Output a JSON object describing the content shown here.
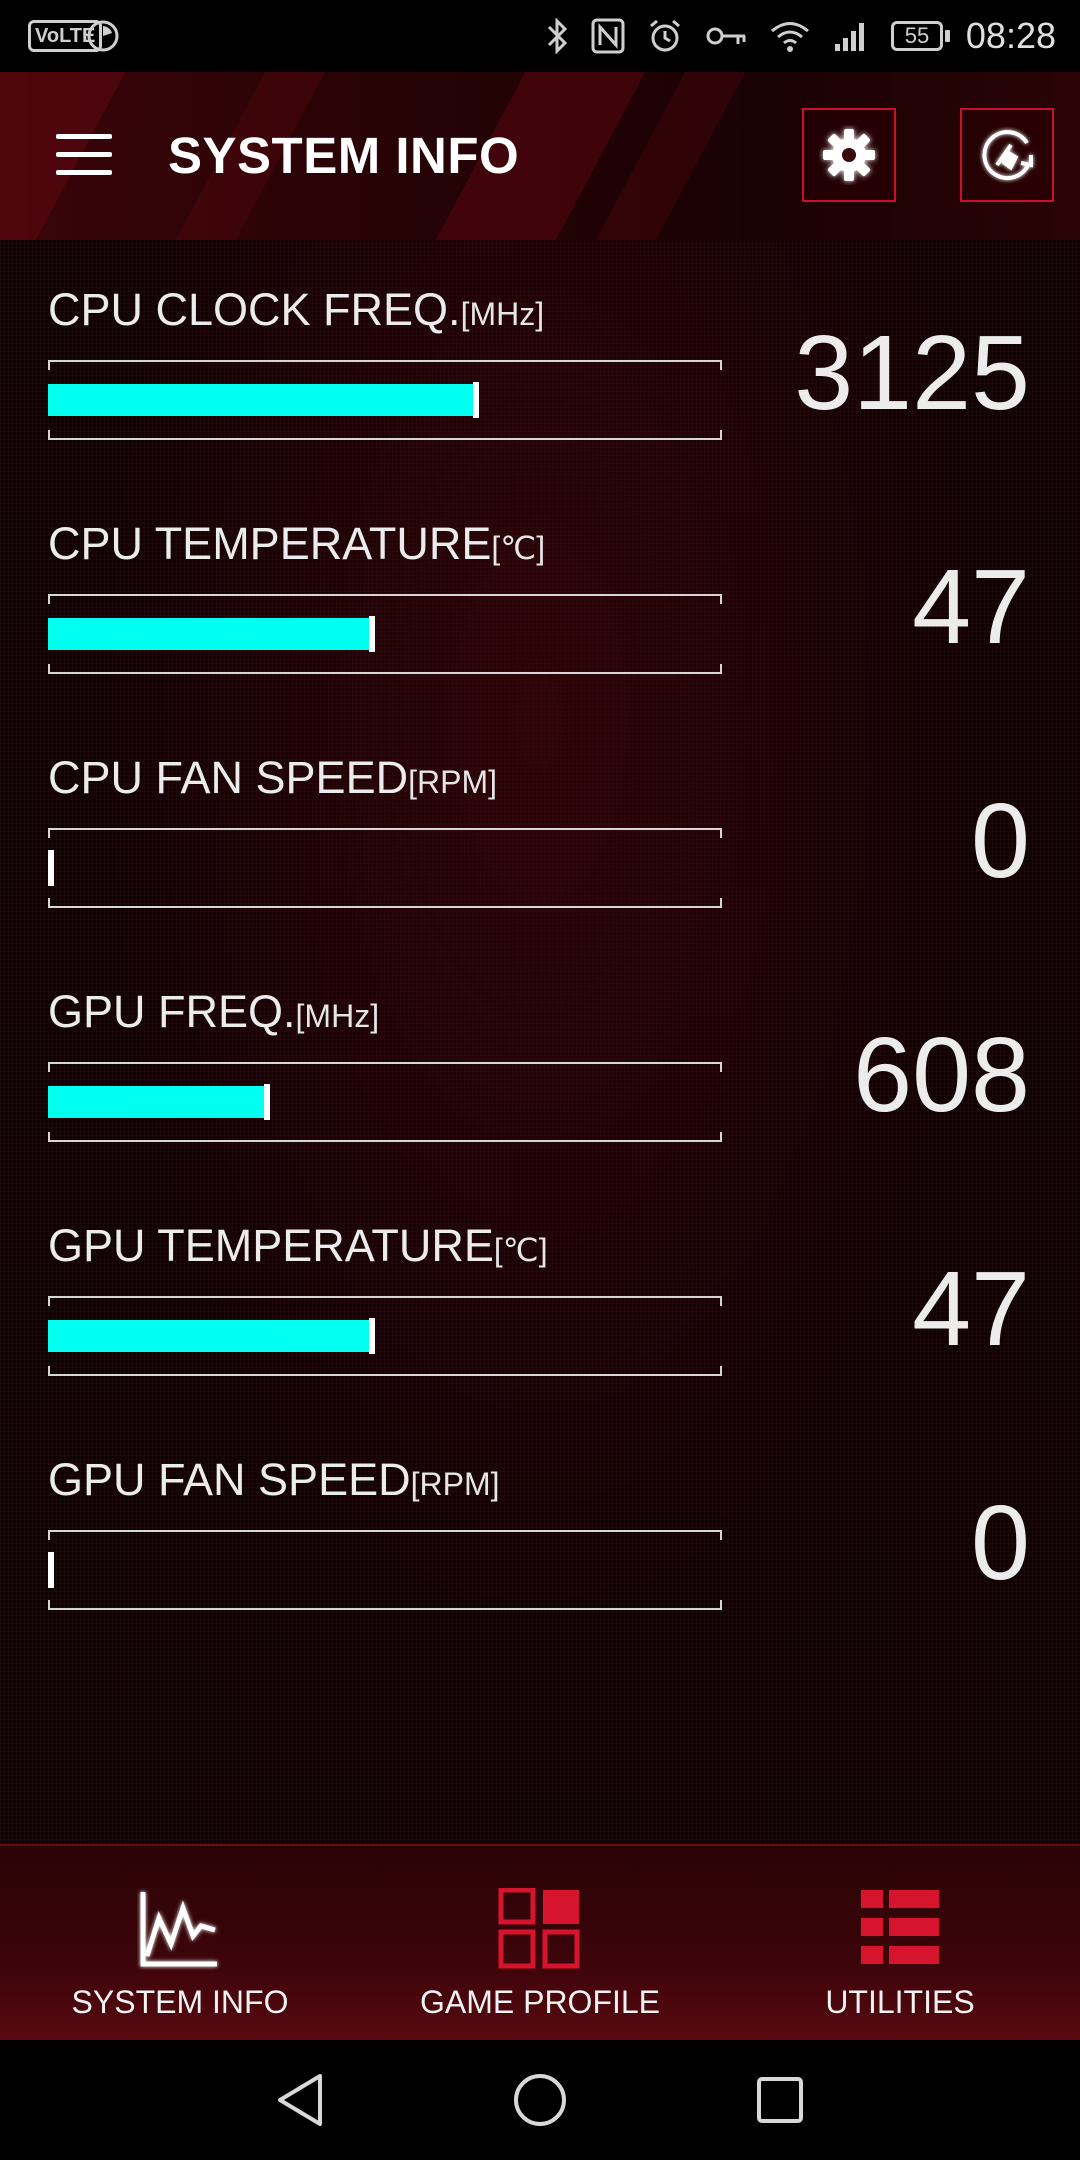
{
  "status_bar": {
    "volte": "VoLTE",
    "battery": "55",
    "time": "08:28",
    "icons": [
      "bluetooth-icon",
      "nfc-icon",
      "alarm-icon",
      "vpn-key-icon",
      "wifi-icon",
      "signal-icon"
    ]
  },
  "app_bar": {
    "title": "SYSTEM INFO"
  },
  "metrics": [
    {
      "label": "CPU CLOCK FREQ.",
      "unit": "[MHz]",
      "value": "3125",
      "fill_fraction": 0.635
    },
    {
      "label": "CPU TEMPERATURE",
      "unit": "[℃]",
      "value": "47",
      "fill_fraction": 0.48
    },
    {
      "label": "CPU FAN SPEED",
      "unit": "[RPM]",
      "value": "0",
      "fill_fraction": 0.0
    },
    {
      "label": "GPU FREQ.",
      "unit": "[MHz]",
      "value": "608",
      "fill_fraction": 0.325
    },
    {
      "label": "GPU TEMPERATURE",
      "unit": "[℃]",
      "value": "47",
      "fill_fraction": 0.48
    },
    {
      "label": "GPU FAN SPEED",
      "unit": "[RPM]",
      "value": "0",
      "fill_fraction": 0.0
    }
  ],
  "bottom_nav": {
    "items": [
      {
        "label": "SYSTEM INFO",
        "icon": "line-chart-icon"
      },
      {
        "label": "GAME PROFILE",
        "icon": "grid-icon"
      },
      {
        "label": "UTILITIES",
        "icon": "list-icon"
      }
    ]
  },
  "colors": {
    "accent": "#c8102e",
    "bar_fill": "#00ffee",
    "background": "#110204"
  }
}
